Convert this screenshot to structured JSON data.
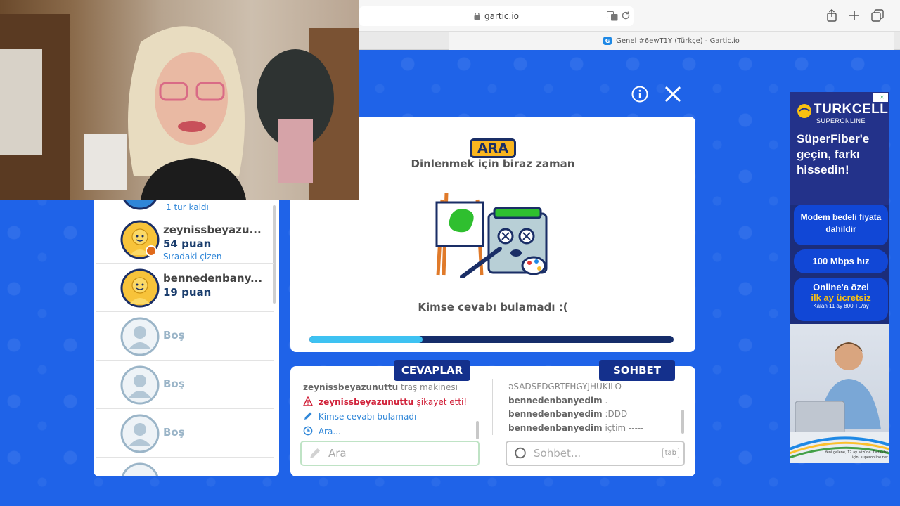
{
  "browser": {
    "url": "gartic.io",
    "tab_title": "Genel #6ewT1Y (Türkçe) - Gartic.io",
    "tab_favicon": "G"
  },
  "players": {
    "top_partial_note": "1 tur kaldı",
    "list": [
      {
        "name": "zeynissbeyazu...",
        "points": "54 puan",
        "note": "Sıradaki çizen"
      },
      {
        "name": "bennedenbany...",
        "points": "19 puan",
        "note": ""
      }
    ],
    "empty_slots": [
      "Boş",
      "Boş",
      "Boş"
    ]
  },
  "card": {
    "badge": "ARA",
    "subtitle": "Dinlenmek için biraz zaman",
    "message": "Kimse cevabı bulamadı :(",
    "progress_fraction": 0.31
  },
  "answers_panel": {
    "tab_label": "CEVAPLAR",
    "lines": [
      {
        "user": "zeynissbeyazunuttu",
        "text": "traş makinesı"
      }
    ],
    "alert": {
      "user": "zeynissbeyazunuttu",
      "text": "şikayet etti!"
    },
    "info_none": "Kimse cevabı bulamadı",
    "info_break": "Ara...",
    "input_placeholder": "Ara"
  },
  "chat_panel": {
    "tab_label": "SOHBET",
    "first_line": "əSADSFDGRTFHGYJHUKILO",
    "lines": [
      {
        "user": "bennedenbanyedim",
        "text": "."
      },
      {
        "user": "bennedenbanyedim",
        "text": ":DDD"
      },
      {
        "user": "bennedenbanyedim",
        "text": "içtim -----"
      }
    ],
    "input_placeholder": "Sohbet...",
    "tab_key": "tab"
  },
  "ad": {
    "brand": "TURKCELL",
    "brand_sub": "SUPERONLINE",
    "headline": "SüperFiber'e geçin, farkı hissedin!",
    "pill1": "Modem bedeli fiyata dahildir",
    "pill2": "100 Mbps hız",
    "pill3_line1": "Online'a özel",
    "pill3_line2": "ilk ay ücretsiz",
    "pill3_line3": "Kalan 11 ay 800 TL/ay",
    "fine_print": "Yeni gelene, 12 ay sözüne. Detaylar için: superonline.net"
  },
  "colors": {
    "background": "#1f63e8",
    "navy": "#14308c",
    "badge_yellow": "#f9b51e",
    "timer_fill": "#3ec2f2",
    "alert_red": "#d1223a",
    "info_blue": "#2f86d8"
  }
}
